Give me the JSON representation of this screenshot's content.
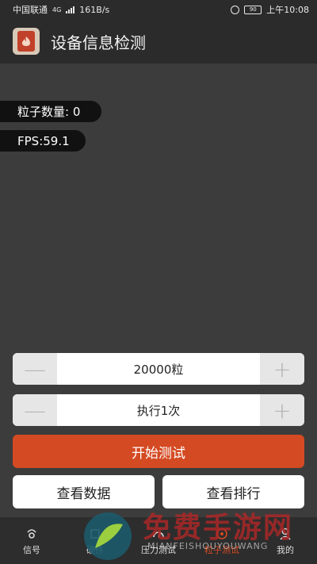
{
  "status": {
    "carrier": "中国联通",
    "net": "4G",
    "speed": "161B/s",
    "battery": "90",
    "time": "上午10:08"
  },
  "app": {
    "title": "设备信息检测"
  },
  "stats": {
    "particles": "粒子数量: 0",
    "fps": "FPS:59.1"
  },
  "controls": {
    "count_value": "20000粒",
    "runs_value": "执行1次",
    "minus": "—",
    "plus": "+",
    "start": "开始测试",
    "view_data": "查看数据",
    "view_rank": "查看排行"
  },
  "nav": {
    "items": [
      {
        "label": "信号"
      },
      {
        "label": "硬件"
      },
      {
        "label": "压力测试"
      },
      {
        "label": "粒子测试"
      },
      {
        "label": "我的"
      }
    ]
  },
  "watermark": {
    "text": "免费手游网",
    "sub": "MIANFEISHOUYOUWANG"
  },
  "colors": {
    "accent": "#d44a22",
    "background": "#3c3c3c",
    "bar": "#2b2b2b"
  }
}
